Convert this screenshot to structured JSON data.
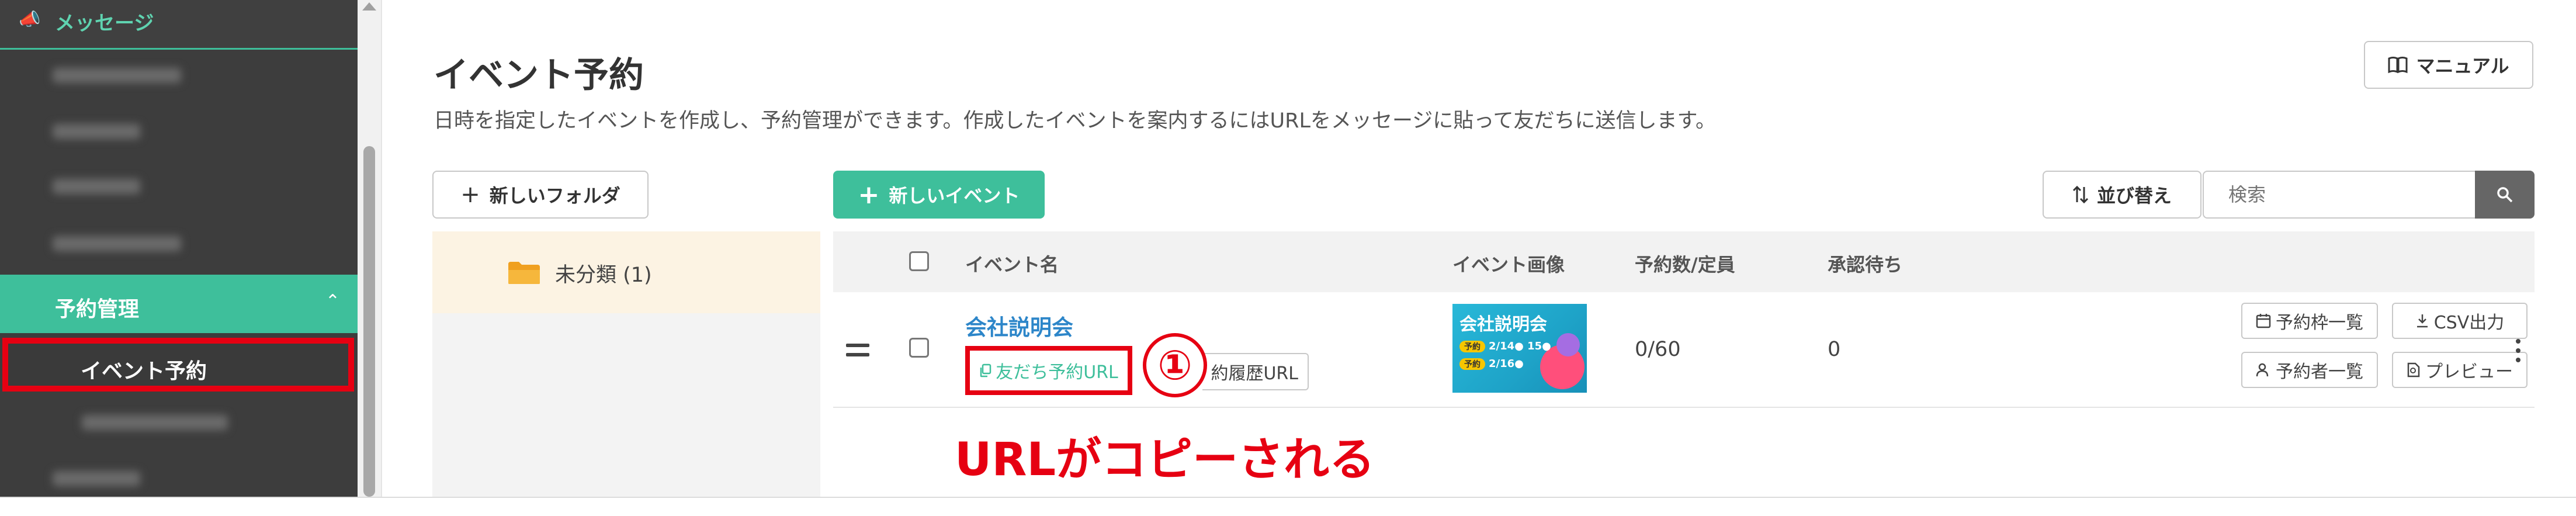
{
  "sidebar": {
    "header_label": "メッセージ",
    "section_label": "予約管理",
    "active_item_label": "イベント予約"
  },
  "main": {
    "title": "イベント予約",
    "description": "日時を指定したイベントを作成し、予約管理ができます。作成したイベントを案内するにはURLをメッセージに貼って友だちに送信します。",
    "manual_button": "マニュアル",
    "new_folder_button": "新しいフォルダ",
    "new_event_button": "新しいイベント",
    "sort_button": "並び替え",
    "search_placeholder": "検索"
  },
  "folders": [
    {
      "label": "未分類 (1)"
    }
  ],
  "table": {
    "columns": [
      "イベント名",
      "イベント画像",
      "予約数/定員",
      "承認待ち"
    ],
    "rows": [
      {
        "name": "会社説明会",
        "friend_url_button": "友だち予約URL",
        "history_url_button": "約履歴URL",
        "image": {
          "title": "会社説明会",
          "line1_pill": "予約",
          "line1": "2/14● 15●",
          "line2_pill": "予約",
          "line2": "2/16●"
        },
        "reservations": "0/60",
        "pending": "0",
        "actions": [
          "予約枠一覧",
          "CSV出力",
          "予約者一覧",
          "プレビュー"
        ]
      }
    ]
  },
  "annotation": {
    "step_number": "①",
    "caption": "URLがコピーされる"
  },
  "colors": {
    "accent": "#3ebf9b",
    "sidebar_bg": "#3d3d3d",
    "highlight_red": "#e60012",
    "link_blue": "#2d86c9",
    "folder_selected_bg": "#fcf3e3"
  }
}
